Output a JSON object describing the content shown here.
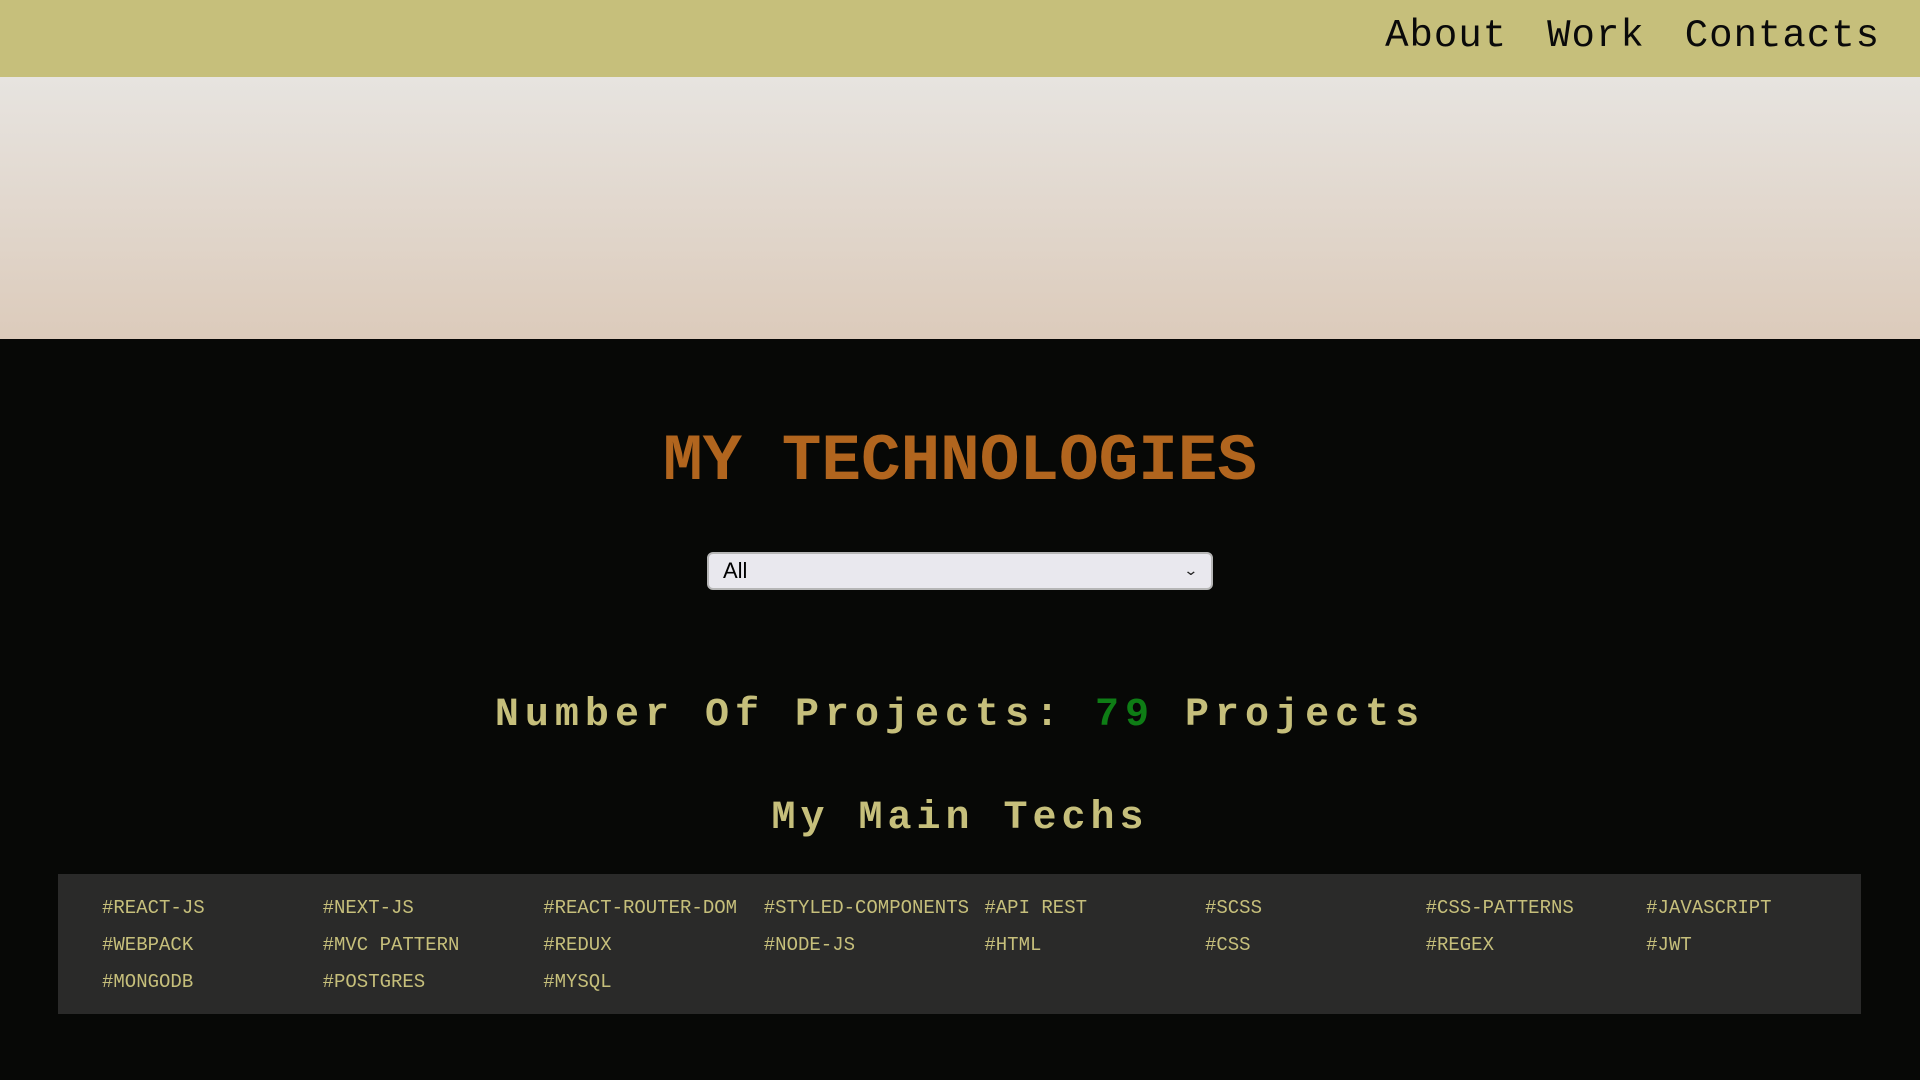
{
  "nav": {
    "items": [
      {
        "label": "About"
      },
      {
        "label": "Work"
      },
      {
        "label": "Contacts"
      }
    ]
  },
  "technologies": {
    "title": "MY TECHNOLOGIES",
    "filter": {
      "selected": "All"
    },
    "projects": {
      "label": "Number Of Projects:",
      "count": "79",
      "unit": "Projects"
    },
    "main_techs_title": "My Main Techs",
    "tags": [
      "#REACT-JS",
      "#NEXT-JS",
      "#REACT-ROUTER-DOM",
      "#STYLED-COMPONENTS",
      "#API REST",
      "#SCSS",
      "#CSS-PATTERNS",
      "#JAVASCRIPT",
      "#WEBPACK",
      "#MVC PATTERN",
      "#REDUX",
      "#NODE-JS",
      "#HTML",
      "#CSS",
      "#REGEX",
      "#JWT",
      "#MONGODB",
      "#POSTGRES",
      "#MYSQL"
    ]
  },
  "colors": {
    "nav_background": "#c6bf7b",
    "title_accent": "#b1651e",
    "text_gold": "#c6bf7b",
    "count_green": "#0e7d15",
    "section_background": "#070806",
    "tags_panel": "#2a2a29"
  },
  "icons": {
    "select_arrow": "chevron-down-icon"
  }
}
